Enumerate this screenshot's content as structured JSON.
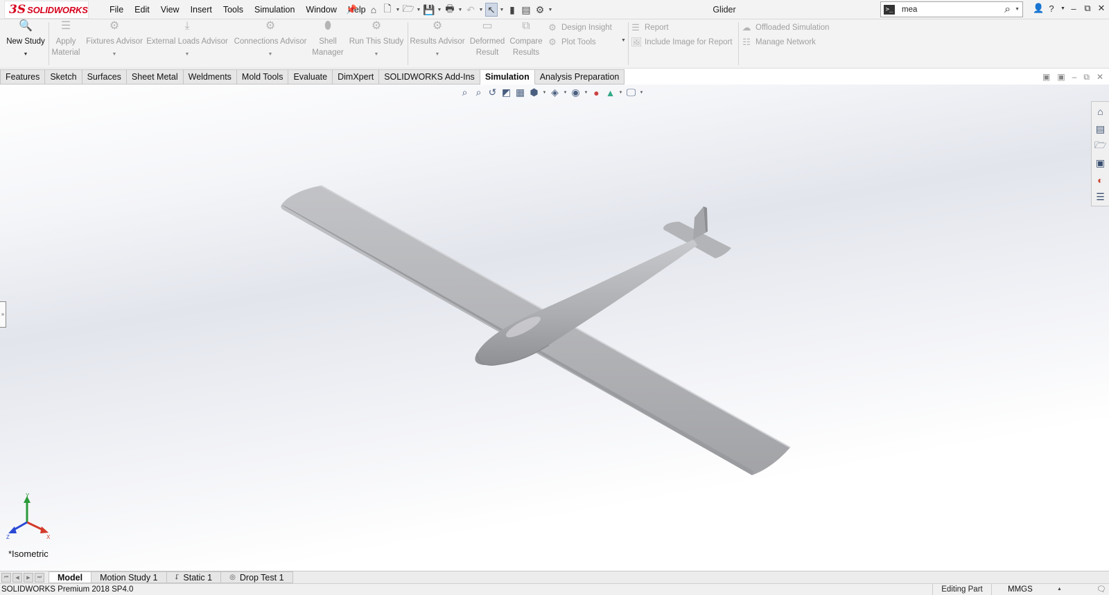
{
  "app": {
    "logo_mark": "3S",
    "logo_text": "SOLIDWORKS",
    "document_title": "Glider"
  },
  "menu": [
    "File",
    "Edit",
    "View",
    "Insert",
    "Tools",
    "Simulation",
    "Window",
    "Help"
  ],
  "quick_access_icons": [
    "home-icon",
    "new-document-icon",
    "open-icon",
    "save-icon",
    "print-icon",
    "undo-icon",
    "select-icon",
    "rebuild-icon",
    "file-properties-icon",
    "options-icon"
  ],
  "search": {
    "value": "mea"
  },
  "command_manager": {
    "new_study": "New Study",
    "apply_material": [
      "Apply",
      "Material"
    ],
    "fixtures_advisor": "Fixtures Advisor",
    "external_loads_advisor": "External Loads Advisor",
    "connections_advisor": "Connections Advisor",
    "shell_manager": [
      "Shell",
      "Manager"
    ],
    "run_this_study": "Run This Study",
    "results_advisor": "Results Advisor",
    "deformed_result": [
      "Deformed",
      "Result"
    ],
    "compare_results": [
      "Compare",
      "Results"
    ],
    "design_insight": "Design Insight",
    "plot_tools": "Plot Tools",
    "report": "Report",
    "include_image_for_report": "Include Image for Report",
    "offloaded_simulation": "Offloaded Simulation",
    "manage_network": "Manage Network"
  },
  "tabs": [
    {
      "label": "Features",
      "active": false
    },
    {
      "label": "Sketch",
      "active": false
    },
    {
      "label": "Surfaces",
      "active": false
    },
    {
      "label": "Sheet Metal",
      "active": false
    },
    {
      "label": "Weldments",
      "active": false
    },
    {
      "label": "Mold Tools",
      "active": false
    },
    {
      "label": "Evaluate",
      "active": false
    },
    {
      "label": "DimXpert",
      "active": false
    },
    {
      "label": "SOLIDWORKS Add-Ins",
      "active": false
    },
    {
      "label": "Simulation",
      "active": true
    },
    {
      "label": "Analysis Preparation",
      "active": false
    }
  ],
  "viewport": {
    "view_name": "*Isometric",
    "triad_labels": {
      "x": "X",
      "y": "Y",
      "z": "Z"
    }
  },
  "bottom_tabs": [
    {
      "label": "Model",
      "active": true,
      "icon": ""
    },
    {
      "label": "Motion Study 1",
      "active": false,
      "icon": ""
    },
    {
      "label": "Static 1",
      "active": false,
      "icon": "static-study-icon"
    },
    {
      "label": "Drop Test 1",
      "active": false,
      "icon": "drop-test-icon"
    }
  ],
  "status": {
    "version": "SOLIDWORKS Premium 2018 SP4.0",
    "mode": "Editing Part",
    "units": "MMGS"
  }
}
